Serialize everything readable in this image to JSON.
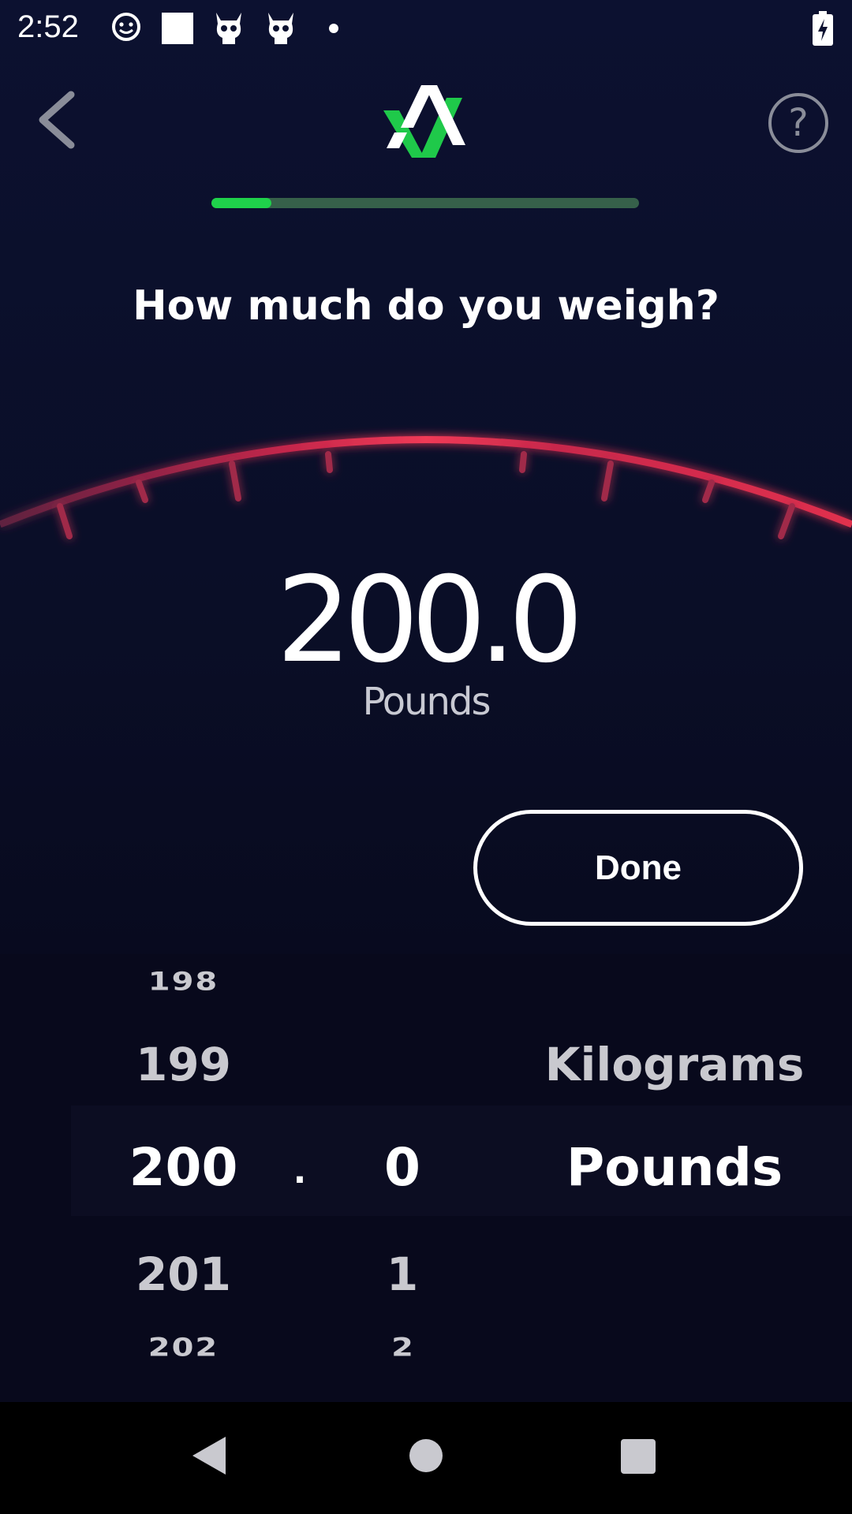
{
  "status_bar": {
    "time": "2:52",
    "icons": [
      "messenger-icon",
      "square-icon",
      "demon-skull-icon",
      "demon-skull-icon",
      "dot-icon",
      "battery-charging-icon"
    ]
  },
  "app_bar": {
    "back_icon": "chevron-left-icon",
    "logo": "app-logo",
    "help_label": "?"
  },
  "progress": {
    "fraction": 0.14,
    "fill_color": "#1fd14b",
    "track_color": "#36604a"
  },
  "question": "How much do you weigh?",
  "reading": {
    "value": "200.0",
    "unit": "Pounds"
  },
  "done_label": "Done",
  "picker": {
    "integers": [
      "198",
      "199",
      "200",
      "201",
      "202"
    ],
    "separator": ".",
    "decimals": [
      "0",
      "1",
      "2"
    ],
    "units": [
      "Kilograms",
      "Pounds"
    ],
    "selected_integer": "200",
    "selected_decimal": "0",
    "selected_unit": "Pounds"
  },
  "colors": {
    "gauge_red": "#e8304f",
    "needle_orange": "#f0901e",
    "accent_green": "#1fd14b"
  },
  "nav_bar": {
    "icons": [
      "back-triangle-icon",
      "home-circle-icon",
      "recents-square-icon"
    ]
  }
}
